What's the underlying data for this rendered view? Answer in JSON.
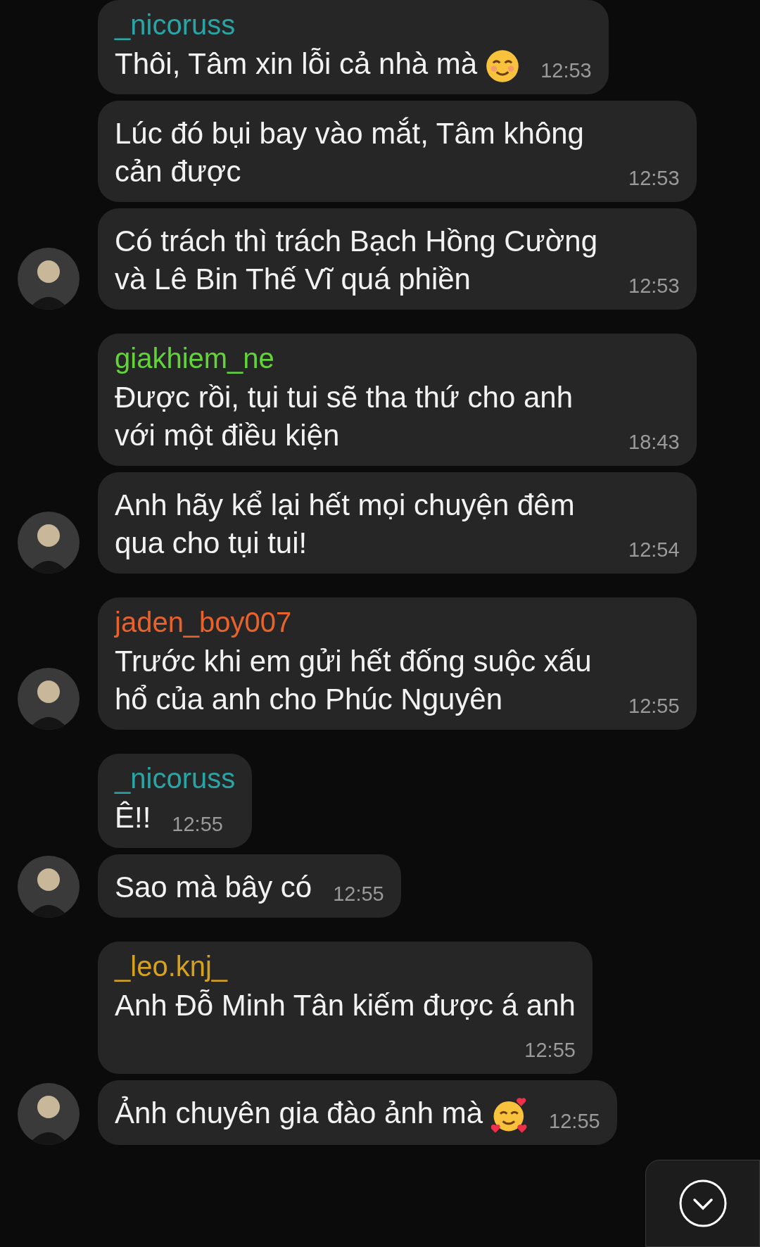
{
  "groups": [
    {
      "sender": "_nicoruss",
      "color": "#2aa5a5",
      "messages": [
        {
          "kind": "smile",
          "text": "Thôi, Tâm xin lỗi cả nhà mà",
          "time": "12:53"
        },
        {
          "kind": "plain",
          "text": "Lúc đó bụi bay vào mắt, Tâm không cản được",
          "time": "12:53"
        },
        {
          "kind": "plain",
          "text": "Có trách thì trách Bạch Hồng Cường và Lê Bin Thế Vĩ quá phiền",
          "time": "12:53"
        }
      ]
    },
    {
      "sender": "giakhiem_ne",
      "color": "#62d43a",
      "messages": [
        {
          "kind": "plain",
          "text": "Được rồi, tụi tui sẽ tha thứ cho anh với một điều kiện",
          "time": "18:43"
        },
        {
          "kind": "plain",
          "text": "Anh hãy kể lại hết mọi chuyện đêm qua cho tụi tui!",
          "time": "12:54"
        }
      ]
    },
    {
      "sender": "jaden_boy007",
      "color": "#e8622c",
      "messages": [
        {
          "kind": "plain",
          "text": "Trước khi em gửi hết đống suộc xấu hổ của anh cho Phúc Nguyên",
          "time": "12:55"
        }
      ]
    },
    {
      "sender": "_nicoruss",
      "color": "#2aa5a5",
      "messages": [
        {
          "kind": "plain",
          "text": "Ê!!",
          "time": "12:55"
        },
        {
          "kind": "plain",
          "text": "Sao mà bây có",
          "time": "12:55"
        }
      ]
    },
    {
      "sender": "_leo.knj_",
      "color": "#d6a21e",
      "messages": [
        {
          "kind": "plain",
          "text": "Anh Đỗ Minh Tân kiếm được á anh",
          "time": "12:55",
          "tall": true
        },
        {
          "kind": "hearts",
          "text": "Ảnh chuyên gia đào ảnh mà",
          "time": "12:55"
        }
      ]
    }
  ]
}
